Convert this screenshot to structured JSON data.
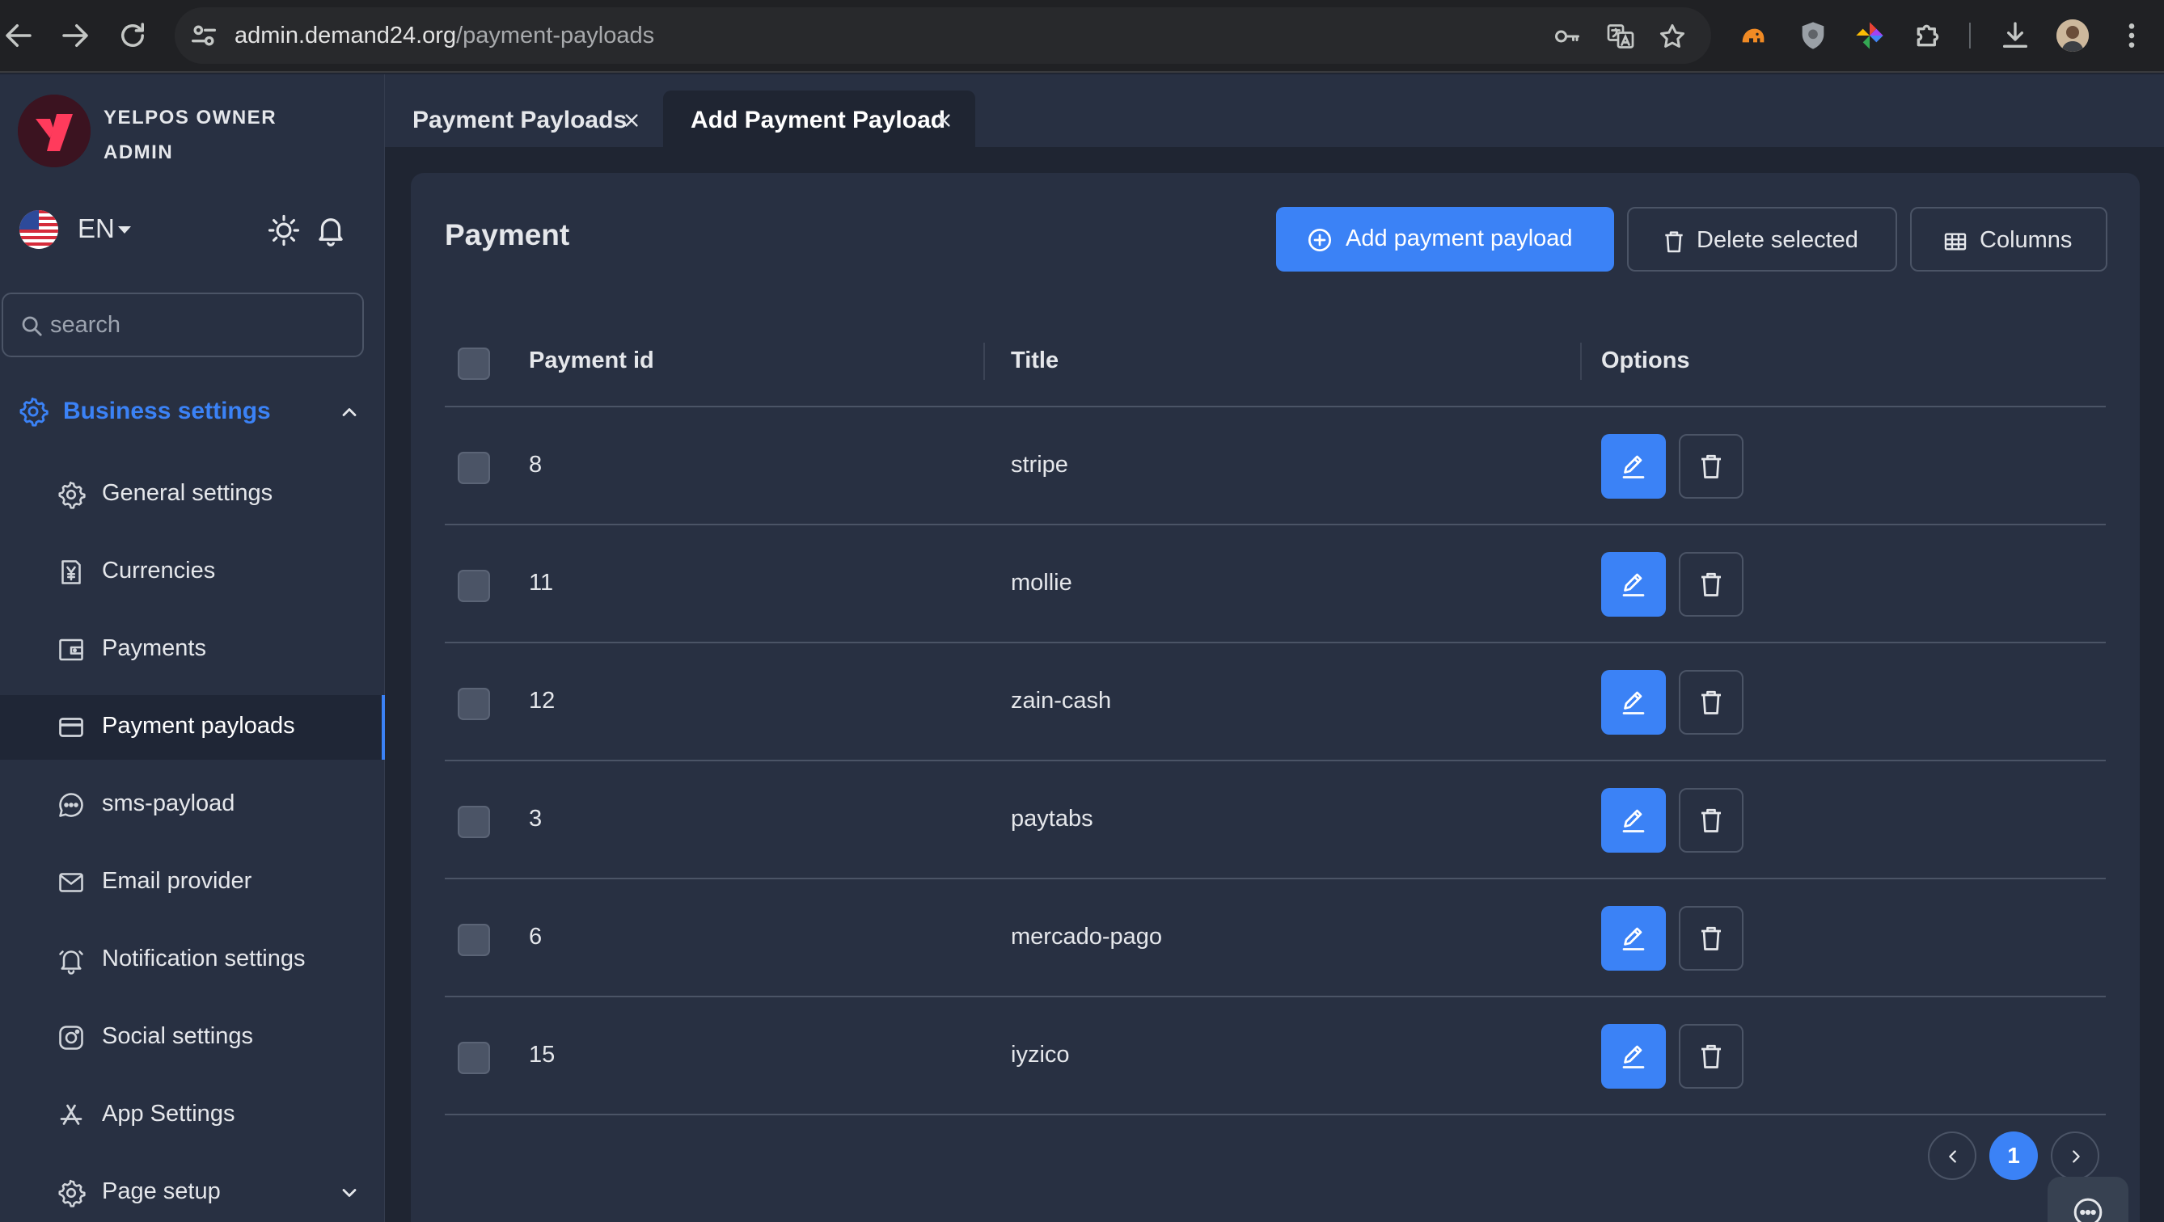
{
  "browser": {
    "url_host": "admin.demand24.org",
    "url_path": "/payment-payloads"
  },
  "sidebar": {
    "org_line1": "YELPOS OWNER",
    "org_line2": "ADMIN",
    "language": "EN",
    "search_placeholder": "search",
    "section_label": "Business settings",
    "items": [
      {
        "label": "General settings",
        "icon": "gear-icon"
      },
      {
        "label": "Currencies",
        "icon": "currency-icon"
      },
      {
        "label": "Payments",
        "icon": "wallet-icon"
      },
      {
        "label": "Payment payloads",
        "icon": "credit-card-icon",
        "active": true
      },
      {
        "label": "sms-payload",
        "icon": "chat-bubble-icon"
      },
      {
        "label": "Email provider",
        "icon": "mail-icon"
      },
      {
        "label": "Notification settings",
        "icon": "bell-icon"
      },
      {
        "label": "Social settings",
        "icon": "instagram-icon"
      },
      {
        "label": "App Settings",
        "icon": "app-store-icon"
      },
      {
        "label": "Page setup",
        "icon": "gear-icon"
      }
    ]
  },
  "tabs": [
    {
      "label": "Payment Payloads",
      "active": false
    },
    {
      "label": "Add Payment Payload",
      "active": true
    }
  ],
  "main": {
    "title": "Payment",
    "add_button": "Add payment payload",
    "delete_button": "Delete selected",
    "columns_button": "Columns",
    "columns": [
      "Payment id",
      "Title",
      "Options"
    ],
    "rows": [
      {
        "id": "8",
        "title": "stripe"
      },
      {
        "id": "11",
        "title": "mollie"
      },
      {
        "id": "12",
        "title": "zain-cash"
      },
      {
        "id": "3",
        "title": "paytabs"
      },
      {
        "id": "6",
        "title": "mercado-pago"
      },
      {
        "id": "15",
        "title": "iyzico"
      }
    ],
    "current_page": "1"
  },
  "colors": {
    "accent": "#3b82f6",
    "sidebar_bg": "#283042",
    "page_bg": "#1f2532"
  }
}
